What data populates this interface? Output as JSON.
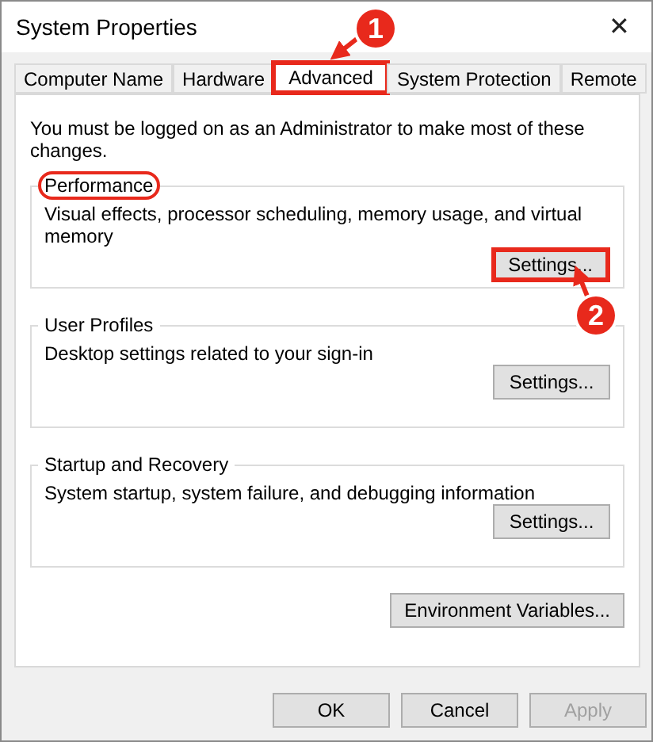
{
  "window": {
    "title": "System Properties",
    "close": "✕"
  },
  "tabs": [
    {
      "label": "Computer Name",
      "selected": false,
      "highlighted": false
    },
    {
      "label": "Hardware",
      "selected": false,
      "highlighted": false
    },
    {
      "label": "Advanced",
      "selected": true,
      "highlighted": true
    },
    {
      "label": "System Protection",
      "selected": false,
      "highlighted": false
    },
    {
      "label": "Remote",
      "selected": false,
      "highlighted": false
    }
  ],
  "notice": "You must be logged on as an Administrator to make most of these changes.",
  "groups": [
    {
      "title": "Performance",
      "title_highlighted": true,
      "description": "Visual effects, processor scheduling, memory usage, and virtual memory",
      "button": {
        "label": "Settings...",
        "highlighted": true
      }
    },
    {
      "title": "User Profiles",
      "title_highlighted": false,
      "description": "Desktop settings related to your sign-in",
      "button": {
        "label": "Settings...",
        "highlighted": false
      }
    },
    {
      "title": "Startup and Recovery",
      "title_highlighted": false,
      "description": "System startup, system failure, and debugging information",
      "button": {
        "label": "Settings...",
        "highlighted": false
      }
    }
  ],
  "environment_button": {
    "label": "Environment Variables..."
  },
  "buttons": [
    {
      "label": "OK",
      "disabled": false
    },
    {
      "label": "Cancel",
      "disabled": false
    },
    {
      "label": "Apply",
      "disabled": true
    }
  ],
  "annotations": [
    {
      "number": "1"
    },
    {
      "number": "2"
    }
  ]
}
